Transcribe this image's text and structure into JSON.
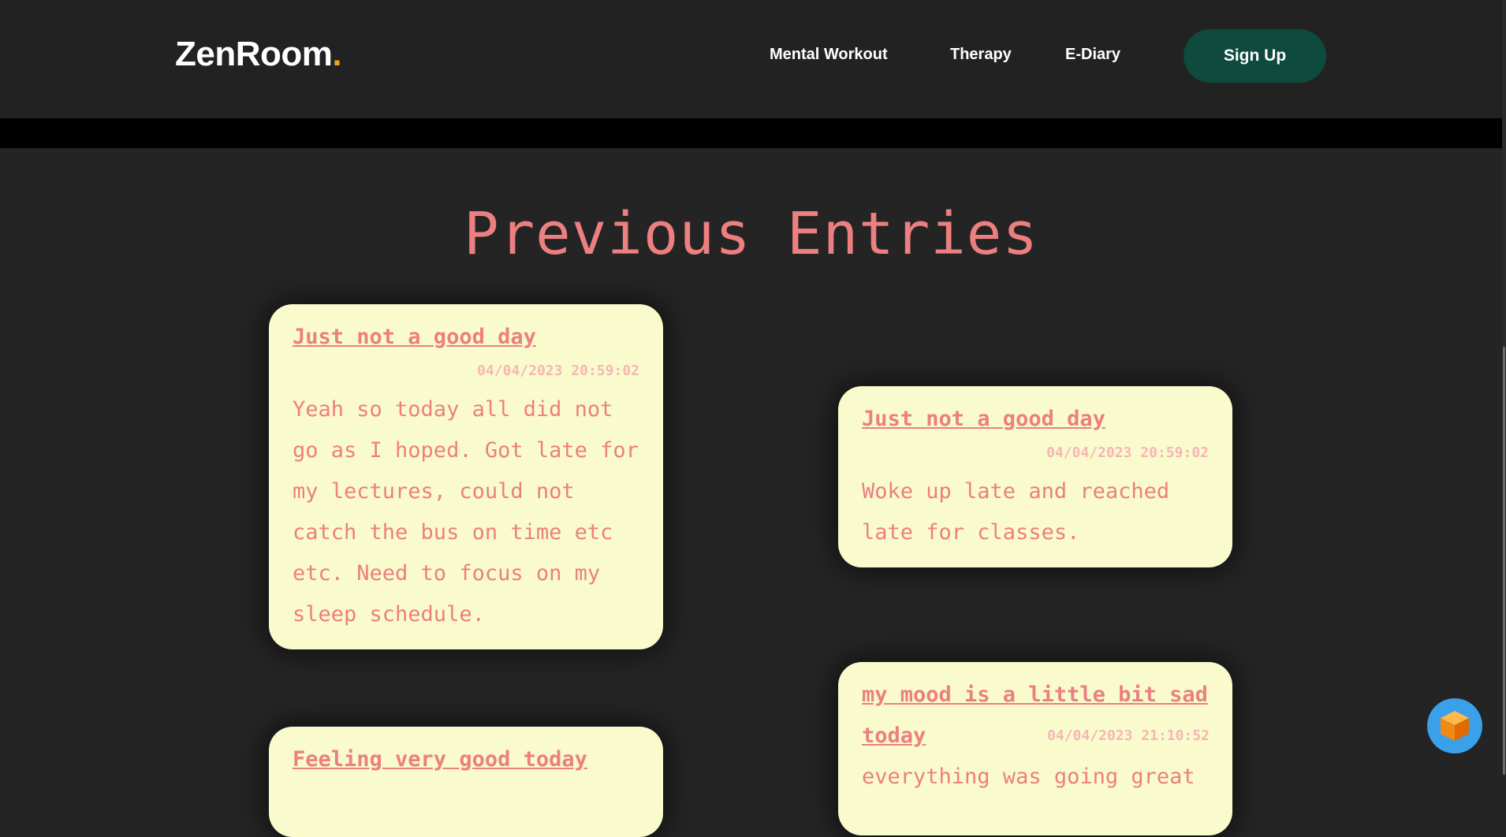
{
  "brand": {
    "name": "ZenRoom",
    "dot": ".",
    "dot_color": "#f0a21a"
  },
  "nav": {
    "links": [
      {
        "label": "Mental Workout"
      },
      {
        "label": "Therapy"
      },
      {
        "label": "E-Diary"
      }
    ],
    "signup_label": "Sign Up"
  },
  "section": {
    "title": "Previous Entries"
  },
  "entries": [
    {
      "title": "Just not a good day",
      "date": "04/04/2023 20:59:02",
      "body": "Yeah so today all did not go as I hoped. Got late for my lectures, could not catch the bus on time etc etc. Need to focus on my sleep schedule."
    },
    {
      "title": "Just not a good day",
      "date": "04/04/2023 20:59:02",
      "body": "Woke up late and reached late for classes."
    },
    {
      "title": "my mood is a little bit sad today",
      "date": "04/04/2023 21:10:52",
      "body": "everything was going great"
    },
    {
      "title": "Feeling very good today",
      "date": "",
      "body": ""
    }
  ],
  "colors": {
    "page_bg": "#242424",
    "card_bg": "#fafbcd",
    "accent_text": "#ec7f7f",
    "signup_bg": "#0e4a3d",
    "chat_button": "#3aa0ea"
  },
  "icons": {
    "chat_button": "cube-icon"
  }
}
